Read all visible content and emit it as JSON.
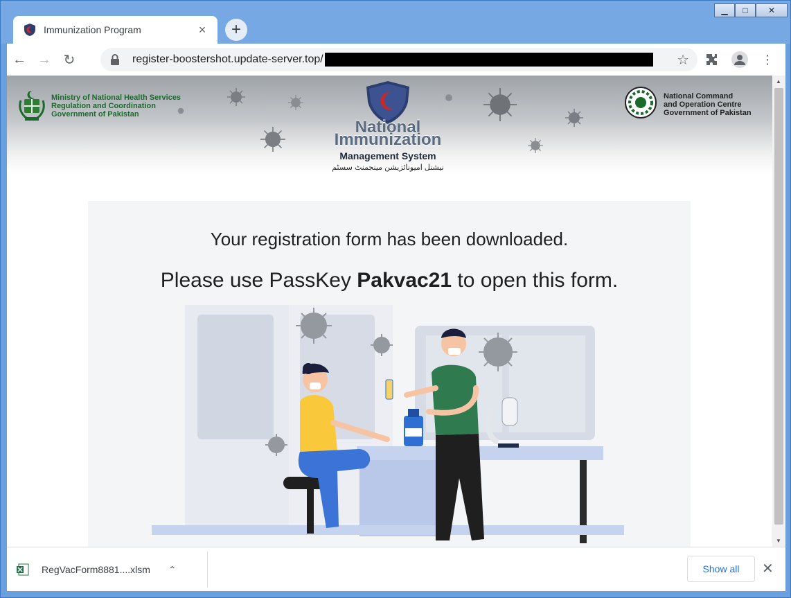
{
  "window": {
    "minimize_label": "▁",
    "maximize_label": "□",
    "close_label": "✕"
  },
  "tab": {
    "title": "Immunization Program",
    "close_label": "×",
    "new_tab_label": "+"
  },
  "toolbar": {
    "back_label": "←",
    "forward_label": "→",
    "reload_label": "↻",
    "url": "register-boostershot.update-server.top/",
    "bookmark_label": "☆",
    "extensions_label": "✱",
    "menu_label": "⋮"
  },
  "banner": {
    "left_lines": [
      "Ministry of National Health Services",
      "Regulation and Coordination",
      "Government of Pakistan"
    ],
    "right_lines": [
      "National Command",
      "and Operation Centre",
      "Government of Pakistan"
    ],
    "nims_line1": "National",
    "nims_line2": "Immunization",
    "nims_line3": "Management System",
    "nims_urdu": "نیشنل امیونائزیشن مینجمنٹ سسٹم"
  },
  "content": {
    "message_1": "Your registration form has been downloaded.",
    "message_2_prefix": "Please use PassKey ",
    "message_2_key": "Pakvac21",
    "message_2_suffix": " to open this form."
  },
  "download": {
    "file_name": "RegVacForm8881....xlsm",
    "chevron": "⌃",
    "show_all_label": "Show all",
    "close_label": "✕"
  },
  "colors": {
    "accent": "#1a73e8",
    "window_frame": "#76a9e3",
    "gov_green": "#1a6a2c"
  }
}
